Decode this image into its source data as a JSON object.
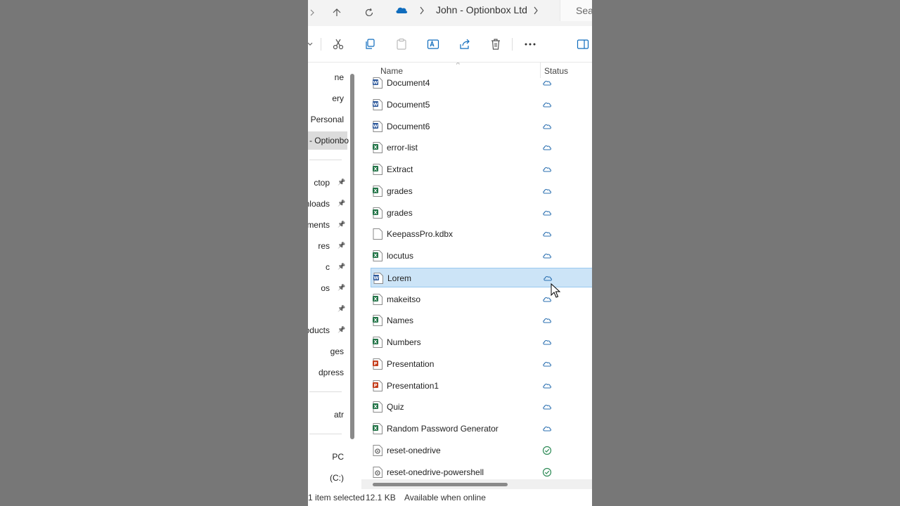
{
  "address": {
    "breadcrumb": "John - Optionbox Ltd",
    "search_placeholder": "Sear"
  },
  "nav": {
    "items": [
      {
        "label": "ne",
        "pinned": false
      },
      {
        "label": "ery",
        "pinned": false
      },
      {
        "label": "- Personal",
        "pinned": false
      },
      {
        "label": "- Optionbo",
        "pinned": false
      },
      {
        "label": "ctop",
        "pinned": true
      },
      {
        "label": "nloads",
        "pinned": true
      },
      {
        "label": "uments",
        "pinned": true
      },
      {
        "label": "res",
        "pinned": true
      },
      {
        "label": "c",
        "pinned": true
      },
      {
        "label": "os",
        "pinned": true
      },
      {
        "label": "",
        "pinned": true
      },
      {
        "label": "roducts",
        "pinned": true
      },
      {
        "label": "ges",
        "pinned": false
      },
      {
        "label": "dpress",
        "pinned": false
      },
      {
        "label": "atr",
        "pinned": false
      },
      {
        "label": "PC",
        "pinned": false
      },
      {
        "label": "(C:)",
        "pinned": false
      }
    ]
  },
  "columns": {
    "name": "Name",
    "status": "Status"
  },
  "files": [
    {
      "name": "Document4",
      "type": "word",
      "status": "cloud"
    },
    {
      "name": "Document5",
      "type": "word",
      "status": "cloud"
    },
    {
      "name": "Document6",
      "type": "word",
      "status": "cloud"
    },
    {
      "name": "error-list",
      "type": "excel",
      "status": "cloud"
    },
    {
      "name": "Extract",
      "type": "excel",
      "status": "cloud"
    },
    {
      "name": "grades",
      "type": "excel",
      "status": "cloud"
    },
    {
      "name": "grades",
      "type": "excel",
      "status": "cloud"
    },
    {
      "name": "KeepassPro.kdbx",
      "type": "generic",
      "status": "cloud"
    },
    {
      "name": "locutus",
      "type": "excel",
      "status": "cloud"
    },
    {
      "name": "Lorem",
      "type": "word",
      "status": "cloud",
      "selected": true
    },
    {
      "name": "makeitso",
      "type": "excel",
      "status": "cloud"
    },
    {
      "name": "Names",
      "type": "excel",
      "status": "cloud"
    },
    {
      "name": "Numbers",
      "type": "excel",
      "status": "cloud"
    },
    {
      "name": "Presentation",
      "type": "powerpoint",
      "status": "cloud"
    },
    {
      "name": "Presentation1",
      "type": "powerpoint",
      "status": "cloud"
    },
    {
      "name": "Quiz",
      "type": "excel",
      "status": "cloud"
    },
    {
      "name": "Random Password Generator",
      "type": "excel",
      "status": "cloud"
    },
    {
      "name": "reset-onedrive",
      "type": "script",
      "status": "synced"
    },
    {
      "name": "reset-onedrive-powershell",
      "type": "script",
      "status": "synced"
    }
  ],
  "statusbar": {
    "selected": "1 item selected",
    "size": "12.1 KB",
    "availability": "Available when online"
  },
  "colors": {
    "selection": "#cce4f7",
    "word": "#2b579a",
    "excel": "#217346",
    "powerpoint": "#c43e1c",
    "cloud": "#2a6fb0",
    "synced": "#2e8b57"
  }
}
